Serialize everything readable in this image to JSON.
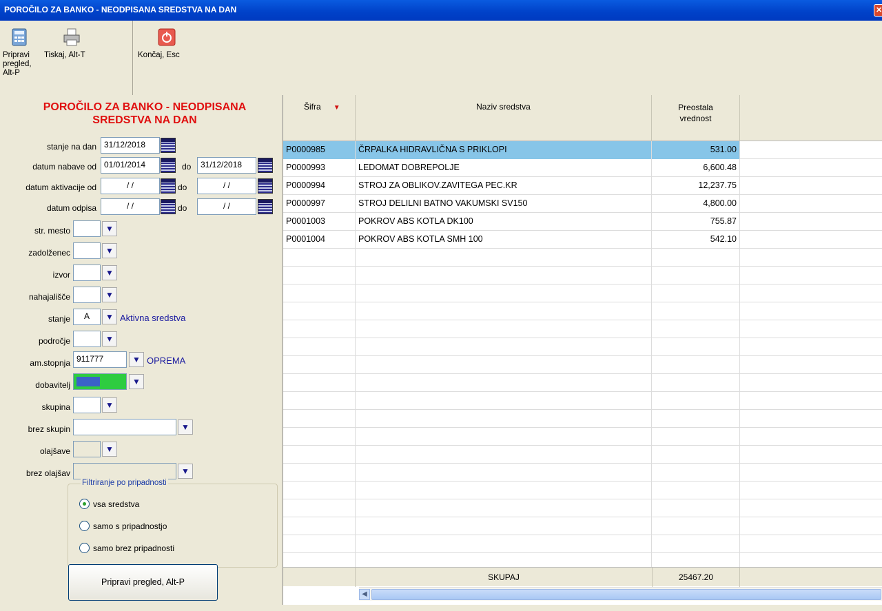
{
  "window": {
    "title": "POROČILO ZA BANKO - NEODPISANA SREDSTVA NA DAN"
  },
  "toolbar": {
    "preview": "Pripravi pregled, Alt-P",
    "print": "Tiskaj, Alt-T",
    "close": "Končaj,  Esc"
  },
  "form": {
    "title": "POROČILO ZA BANKO - NEODPISANA SREDSTVA NA DAN",
    "stanje_na_dan": {
      "label": "stanje na dan",
      "value": "31/12/2018"
    },
    "datum_nabave": {
      "label": "datum nabave od",
      "from": "01/01/2014",
      "to_label": "do",
      "to": "31/12/2018"
    },
    "datum_aktivacije": {
      "label": "datum aktivacije od",
      "from": "/ /",
      "to_label": "do",
      "to": "/ /"
    },
    "datum_odpisa": {
      "label": "datum odpisa",
      "from": "/ /",
      "to_label": "do",
      "to": "/ /"
    },
    "str_mesto": {
      "label": "str. mesto",
      "value": ""
    },
    "zadolzenec": {
      "label": "zadolženec",
      "value": ""
    },
    "izvor": {
      "label": "izvor",
      "value": ""
    },
    "nahajalisce": {
      "label": "nahajališče",
      "value": ""
    },
    "stanje": {
      "label": "stanje",
      "value": "A",
      "hint": "Aktivna sredstva"
    },
    "podrocje": {
      "label": "področje",
      "value": ""
    },
    "am_stopnja": {
      "label": "am.stopnja",
      "value": "911777",
      "hint": "OPREMA"
    },
    "dobavitelj": {
      "label": "dobavitelj",
      "value": ""
    },
    "skupina": {
      "label": "skupina",
      "value": ""
    },
    "brez_skupin": {
      "label": "brez skupin",
      "value": ""
    },
    "olajsave": {
      "label": "olajšave",
      "value": ""
    },
    "brez_olajsav": {
      "label": "brez olajšav",
      "value": ""
    },
    "filter": {
      "title": "Filtriranje po pripadnosti",
      "options": [
        "vsa sredstva",
        "samo s pripadnostjo",
        "samo brez pripadnosti"
      ],
      "selected": 0
    },
    "submit": "Pripravi pregled,  Alt-P"
  },
  "grid": {
    "columns": [
      "Šifra",
      "Naziv sredstva",
      "Preostala vrednost"
    ],
    "rows": [
      {
        "sifra": "P0000985",
        "naziv": "ČRPALKA HIDRAVLIČNA S PRIKLOPI",
        "vrednost": "531.00"
      },
      {
        "sifra": "P0000993",
        "naziv": "LEDOMAT DOBREPOLJE",
        "vrednost": "6,600.48"
      },
      {
        "sifra": "P0000994",
        "naziv": "STROJ ZA OBLIKOV.ZAVITEGA PEC.KR",
        "vrednost": "12,237.75"
      },
      {
        "sifra": "P0000997",
        "naziv": "STROJ DELILNI BATNO VAKUMSKI SV150",
        "vrednost": "4,800.00"
      },
      {
        "sifra": "P0001003",
        "naziv": "POKROV ABS KOTLA DK100",
        "vrednost": "755.87"
      },
      {
        "sifra": "P0001004",
        "naziv": "POKROV ABS KOTLA SMH 100",
        "vrednost": "542.10"
      }
    ],
    "footer": {
      "label": "SKUPAJ",
      "total": "25467.20"
    }
  },
  "colors": {
    "title_red": "#e01010",
    "selection": "#87c5e8",
    "hint_blue": "#1a1aa0",
    "dobavitelj_fill": "#2ecc40"
  }
}
